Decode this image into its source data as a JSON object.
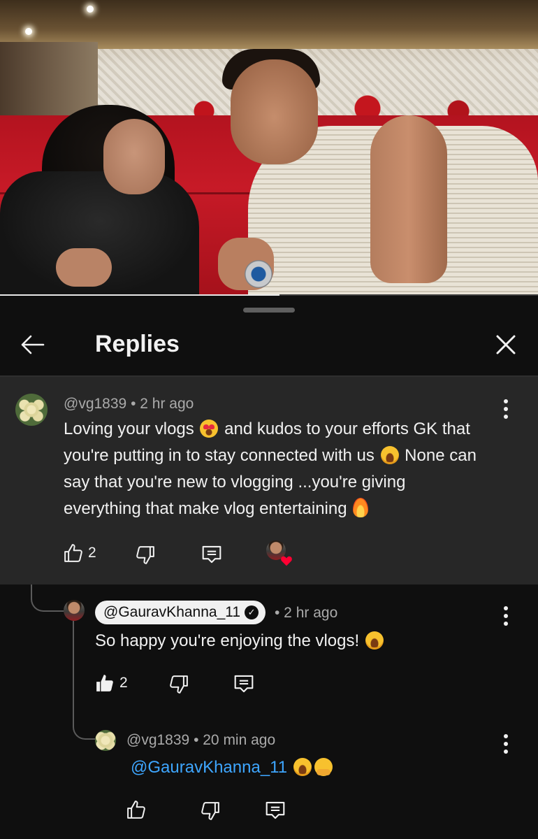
{
  "video": {
    "progress_fraction": 0.52
  },
  "panel": {
    "title": "Replies",
    "back_icon": "arrow-left-icon",
    "close_icon": "close-icon"
  },
  "parent_comment": {
    "handle": "@vg1839",
    "time": "• 2 hr ago",
    "text_parts": [
      "Loving your vlogs ",
      " and kudos to your efforts GK that you're putting in to stay connected with us ",
      " None can say that you're new to vlogging ...you're giving everything that make vlog entertaining "
    ],
    "likes": "2",
    "creator_heart": true
  },
  "reply_1": {
    "handle": "@GauravKhanna_11",
    "verified": true,
    "time": "• 2 hr ago",
    "text": "So happy you're enjoying the vlogs! ",
    "likes": "2",
    "liked": true
  },
  "reply_2": {
    "handle": "@vg1839",
    "time": "• 20 min ago",
    "mention": "@GauravKhanna_11",
    "likes": ""
  },
  "colors": {
    "background": "#0f0f0f",
    "highlight_row": "#272727",
    "mention": "#3ea6ff",
    "heart": "#ff0033",
    "meta_text": "#aaaaaa"
  }
}
